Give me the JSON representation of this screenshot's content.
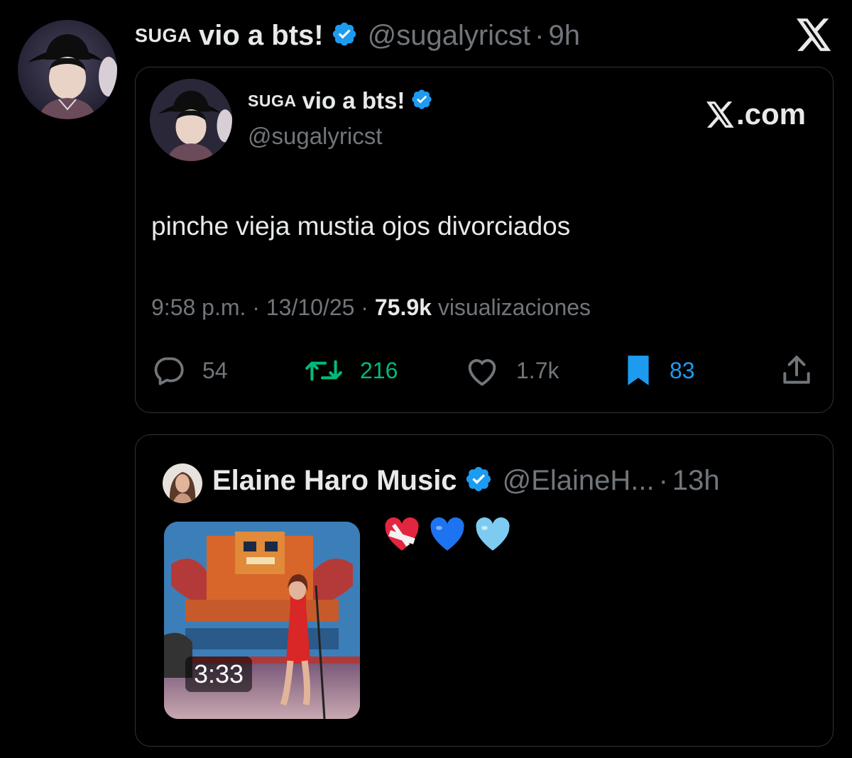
{
  "outer_tweet": {
    "name_small": "SUGA",
    "name_main": "vio a bts!",
    "handle": "@sugalyricst",
    "separator": "·",
    "time": "9h"
  },
  "quoted_card": {
    "name_small": "SUGA",
    "name_main": "vio a bts!",
    "handle": "@sugalyricst",
    "source": ".com",
    "text": "pinche vieja mustia ojos divorciados",
    "meta_time": "9:58 p.m.",
    "meta_sep": " · ",
    "meta_date": "13/10/25",
    "meta_views": "75.9k",
    "meta_views_label": " visualizaciones",
    "replies": "54",
    "reposts": "216",
    "likes": "1.7k",
    "bookmarks": "83"
  },
  "reply_card": {
    "name": "Elaine Haro Music",
    "handle": "@ElaineH...",
    "separator": "·",
    "time": "13h",
    "video_duration": "3:33",
    "emojis": [
      "mending-heart",
      "blue-heart",
      "light-blue-heart"
    ]
  },
  "colors": {
    "background": "#000000",
    "verified": "#1d9bf0",
    "repost": "#00ba7c",
    "bookmark": "#1d9bf0",
    "muted": "#71767b"
  }
}
